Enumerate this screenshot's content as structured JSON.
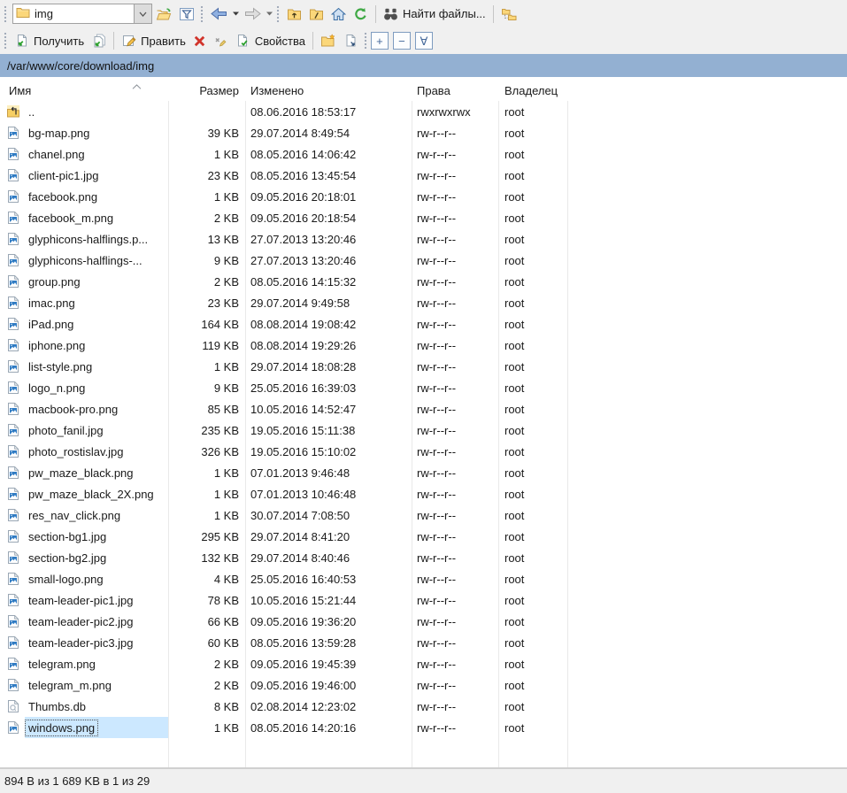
{
  "colors": {
    "pathbar_bg": "#93b0d2",
    "selection_bg": "#cce8ff",
    "toolbar_bg": "#f0f0f0",
    "grid_line": "#e9e9e9"
  },
  "toolbar_main": {
    "directory_combo": {
      "value": "img"
    },
    "find_files_label": "Найти файлы..."
  },
  "toolbar_commands": {
    "get_label": "Получить",
    "edit_label": "Править",
    "properties_label": "Свойства",
    "select_plus": "+",
    "select_minus": "−",
    "select_invert": "∀"
  },
  "pathbar": {
    "path": "/var/www/core/download/img"
  },
  "table": {
    "columns": [
      {
        "label": "Имя",
        "sort": "asc"
      },
      {
        "label": "Размер"
      },
      {
        "label": "Изменено"
      },
      {
        "label": "Права"
      },
      {
        "label": "Владелец"
      }
    ],
    "rows": [
      {
        "name": "..",
        "size": "",
        "modified": "08.06.2016 18:53:17",
        "rights": "rwxrwxrwx",
        "owner": "root",
        "icon": "parent-dir-icon",
        "selected": false
      },
      {
        "name": "bg-map.png",
        "size": "39 KB",
        "modified": "29.07.2014 8:49:54",
        "rights": "rw-r--r--",
        "owner": "root",
        "icon": "image-file-icon",
        "selected": false
      },
      {
        "name": "chanel.png",
        "size": "1 KB",
        "modified": "08.05.2016 14:06:42",
        "rights": "rw-r--r--",
        "owner": "root",
        "icon": "image-file-icon",
        "selected": false
      },
      {
        "name": "client-pic1.jpg",
        "size": "23 KB",
        "modified": "08.05.2016 13:45:54",
        "rights": "rw-r--r--",
        "owner": "root",
        "icon": "image-file-icon",
        "selected": false
      },
      {
        "name": "facebook.png",
        "size": "1 KB",
        "modified": "09.05.2016 20:18:01",
        "rights": "rw-r--r--",
        "owner": "root",
        "icon": "image-file-icon",
        "selected": false
      },
      {
        "name": "facebook_m.png",
        "size": "2 KB",
        "modified": "09.05.2016 20:18:54",
        "rights": "rw-r--r--",
        "owner": "root",
        "icon": "image-file-icon",
        "selected": false
      },
      {
        "name": "glyphicons-halflings.p...",
        "size": "13 KB",
        "modified": "27.07.2013 13:20:46",
        "rights": "rw-r--r--",
        "owner": "root",
        "icon": "image-file-icon",
        "selected": false
      },
      {
        "name": "glyphicons-halflings-...",
        "size": "9 KB",
        "modified": "27.07.2013 13:20:46",
        "rights": "rw-r--r--",
        "owner": "root",
        "icon": "image-file-icon",
        "selected": false
      },
      {
        "name": "group.png",
        "size": "2 KB",
        "modified": "08.05.2016 14:15:32",
        "rights": "rw-r--r--",
        "owner": "root",
        "icon": "image-file-icon",
        "selected": false
      },
      {
        "name": "imac.png",
        "size": "23 KB",
        "modified": "29.07.2014 9:49:58",
        "rights": "rw-r--r--",
        "owner": "root",
        "icon": "image-file-icon",
        "selected": false
      },
      {
        "name": "iPad.png",
        "size": "164 KB",
        "modified": "08.08.2014 19:08:42",
        "rights": "rw-r--r--",
        "owner": "root",
        "icon": "image-file-icon",
        "selected": false
      },
      {
        "name": "iphone.png",
        "size": "119 KB",
        "modified": "08.08.2014 19:29:26",
        "rights": "rw-r--r--",
        "owner": "root",
        "icon": "image-file-icon",
        "selected": false
      },
      {
        "name": "list-style.png",
        "size": "1 KB",
        "modified": "29.07.2014 18:08:28",
        "rights": "rw-r--r--",
        "owner": "root",
        "icon": "image-file-icon",
        "selected": false
      },
      {
        "name": "logo_n.png",
        "size": "9 KB",
        "modified": "25.05.2016 16:39:03",
        "rights": "rw-r--r--",
        "owner": "root",
        "icon": "image-file-icon",
        "selected": false
      },
      {
        "name": "macbook-pro.png",
        "size": "85 KB",
        "modified": "10.05.2016 14:52:47",
        "rights": "rw-r--r--",
        "owner": "root",
        "icon": "image-file-icon",
        "selected": false
      },
      {
        "name": "photo_fanil.jpg",
        "size": "235 KB",
        "modified": "19.05.2016 15:11:38",
        "rights": "rw-r--r--",
        "owner": "root",
        "icon": "image-file-icon",
        "selected": false
      },
      {
        "name": "photo_rostislav.jpg",
        "size": "326 KB",
        "modified": "19.05.2016 15:10:02",
        "rights": "rw-r--r--",
        "owner": "root",
        "icon": "image-file-icon",
        "selected": false
      },
      {
        "name": "pw_maze_black.png",
        "size": "1 KB",
        "modified": "07.01.2013 9:46:48",
        "rights": "rw-r--r--",
        "owner": "root",
        "icon": "image-file-icon",
        "selected": false
      },
      {
        "name": "pw_maze_black_2X.png",
        "size": "1 KB",
        "modified": "07.01.2013 10:46:48",
        "rights": "rw-r--r--",
        "owner": "root",
        "icon": "image-file-icon",
        "selected": false
      },
      {
        "name": "res_nav_click.png",
        "size": "1 KB",
        "modified": "30.07.2014 7:08:50",
        "rights": "rw-r--r--",
        "owner": "root",
        "icon": "image-file-icon",
        "selected": false
      },
      {
        "name": "section-bg1.jpg",
        "size": "295 KB",
        "modified": "29.07.2014 8:41:20",
        "rights": "rw-r--r--",
        "owner": "root",
        "icon": "image-file-icon",
        "selected": false
      },
      {
        "name": "section-bg2.jpg",
        "size": "132 KB",
        "modified": "29.07.2014 8:40:46",
        "rights": "rw-r--r--",
        "owner": "root",
        "icon": "image-file-icon",
        "selected": false
      },
      {
        "name": "small-logo.png",
        "size": "4 KB",
        "modified": "25.05.2016 16:40:53",
        "rights": "rw-r--r--",
        "owner": "root",
        "icon": "image-file-icon",
        "selected": false
      },
      {
        "name": "team-leader-pic1.jpg",
        "size": "78 KB",
        "modified": "10.05.2016 15:21:44",
        "rights": "rw-r--r--",
        "owner": "root",
        "icon": "image-file-icon",
        "selected": false
      },
      {
        "name": "team-leader-pic2.jpg",
        "size": "66 KB",
        "modified": "09.05.2016 19:36:20",
        "rights": "rw-r--r--",
        "owner": "root",
        "icon": "image-file-icon",
        "selected": false
      },
      {
        "name": "team-leader-pic3.jpg",
        "size": "60 KB",
        "modified": "08.05.2016 13:59:28",
        "rights": "rw-r--r--",
        "owner": "root",
        "icon": "image-file-icon",
        "selected": false
      },
      {
        "name": "telegram.png",
        "size": "2 KB",
        "modified": "09.05.2016 19:45:39",
        "rights": "rw-r--r--",
        "owner": "root",
        "icon": "image-file-icon",
        "selected": false
      },
      {
        "name": "telegram_m.png",
        "size": "2 KB",
        "modified": "09.05.2016 19:46:00",
        "rights": "rw-r--r--",
        "owner": "root",
        "icon": "image-file-icon",
        "selected": false
      },
      {
        "name": "Thumbs.db",
        "size": "8 KB",
        "modified": "02.08.2014 12:23:02",
        "rights": "rw-r--r--",
        "owner": "root",
        "icon": "file-icon",
        "selected": false
      },
      {
        "name": "windows.png",
        "size": "1 KB",
        "modified": "08.05.2016 14:20:16",
        "rights": "rw-r--r--",
        "owner": "root",
        "icon": "image-file-icon",
        "selected": true
      }
    ]
  },
  "statusbar": {
    "text": "894 B из 1 689 KB в 1 из 29"
  }
}
